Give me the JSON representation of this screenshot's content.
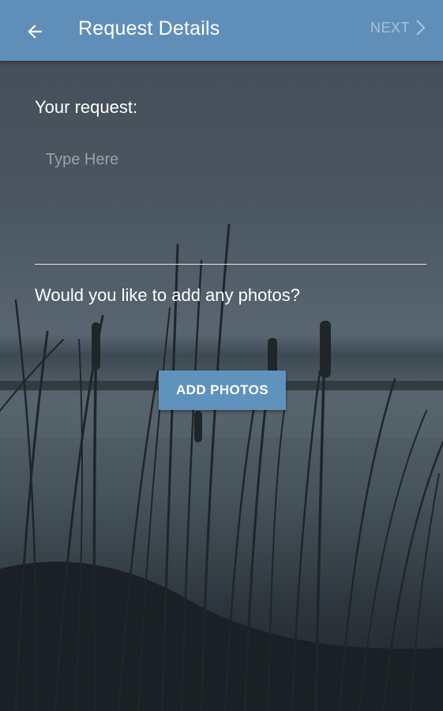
{
  "appbar": {
    "title": "Request Details",
    "back_icon": "arrow-left-icon",
    "next_label": "NEXT",
    "next_icon": "chevron-right-icon",
    "color": "#5f8fb9"
  },
  "form": {
    "request_label": "Your request:",
    "request_placeholder": "Type Here",
    "request_value": "",
    "photos_question": "Would you like to add any photos?",
    "add_photos_label": "ADD PHOTOS"
  },
  "theme": {
    "accent": "#6092be",
    "text": "#ffffff"
  }
}
